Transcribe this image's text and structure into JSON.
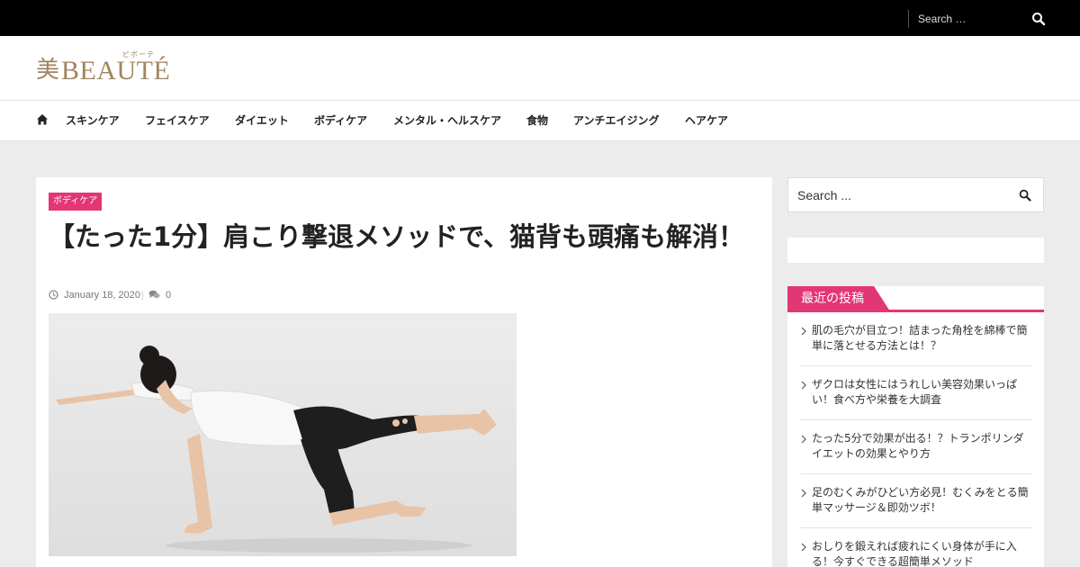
{
  "top_search": {
    "placeholder": "Search …",
    "icon": "search-icon"
  },
  "logo": {
    "kanji": "美",
    "word": "BEAUTÉ",
    "ruby": "ビボーテ",
    "color": "#a08560"
  },
  "nav": {
    "home_icon": "home-icon",
    "items": [
      "スキンケア",
      "フェイスケア",
      "ダイエット",
      "ボディケア",
      "メンタル・ヘルスケア",
      "食物",
      "アンチエイジング",
      "ヘアケア"
    ]
  },
  "article": {
    "category": "ボディケア",
    "title": "【たった1分】肩こり撃退メソッドで、猫背も頭痛も解消！",
    "date": "January 18, 2020",
    "meta_separator": "|",
    "comment_count": "0"
  },
  "sidebar": {
    "search_placeholder": "Search ...",
    "recent_title": "最近の投稿",
    "recent_posts": [
      "肌の毛穴が目立つ！詰まった角栓を綿棒で簡単に落とせる方法とは！？",
      "ザクロは女性にはうれしい美容効果いっぱい！食べ方や栄養を大調査",
      "たった5分で効果が出る！？トランポリンダイエットの効果とやり方",
      "足のむくみがひどい方必見！むくみをとる簡単マッサージ＆即効ツボ！",
      "おしりを鍛えれば疲れにくい身体が手に入る！今すぐできる超簡単メソッド"
    ]
  },
  "colors": {
    "accent": "#e33674",
    "topbar": "#000000",
    "background": "#ececec"
  }
}
